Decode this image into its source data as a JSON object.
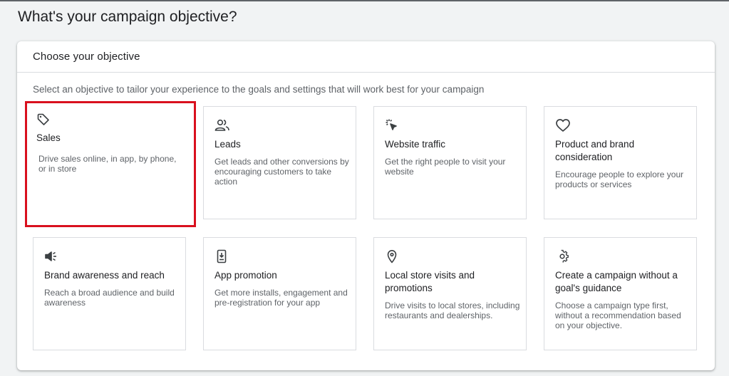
{
  "page_title": "What's your campaign objective?",
  "panel": {
    "header": "Choose your objective",
    "description": "Select an objective to tailor your experience to the goals and settings that will work best for your campaign"
  },
  "accent": {
    "selected_border": "#d9101e"
  },
  "cards": [
    {
      "icon": "tag-icon",
      "title": "Sales",
      "description": "Drive sales online, in app, by phone, or in store",
      "selected": true
    },
    {
      "icon": "people-icon",
      "title": "Leads",
      "description": "Get leads and other conversions by encouraging customers to take action",
      "selected": false
    },
    {
      "icon": "cursor-click-icon",
      "title": "Website traffic",
      "description": "Get the right people to visit your website",
      "selected": false
    },
    {
      "icon": "heart-icon",
      "title": "Product and brand consideration",
      "description": "Encourage people to explore your products or services",
      "selected": false
    },
    {
      "icon": "speaker-icon",
      "title": "Brand awareness and reach",
      "description": "Reach a broad audience and build awareness",
      "selected": false
    },
    {
      "icon": "phone-download-icon",
      "title": "App promotion",
      "description": "Get more installs, engagement and pre-registration for your app",
      "selected": false
    },
    {
      "icon": "location-pin-icon",
      "title": "Local store visits and promotions",
      "description": "Drive visits to local stores, including restaurants and dealerships.",
      "selected": false
    },
    {
      "icon": "gear-icon",
      "title": "Create a campaign without a goal's guidance",
      "description": "Choose a campaign type first, without a recommendation based on your objective.",
      "selected": false
    }
  ]
}
